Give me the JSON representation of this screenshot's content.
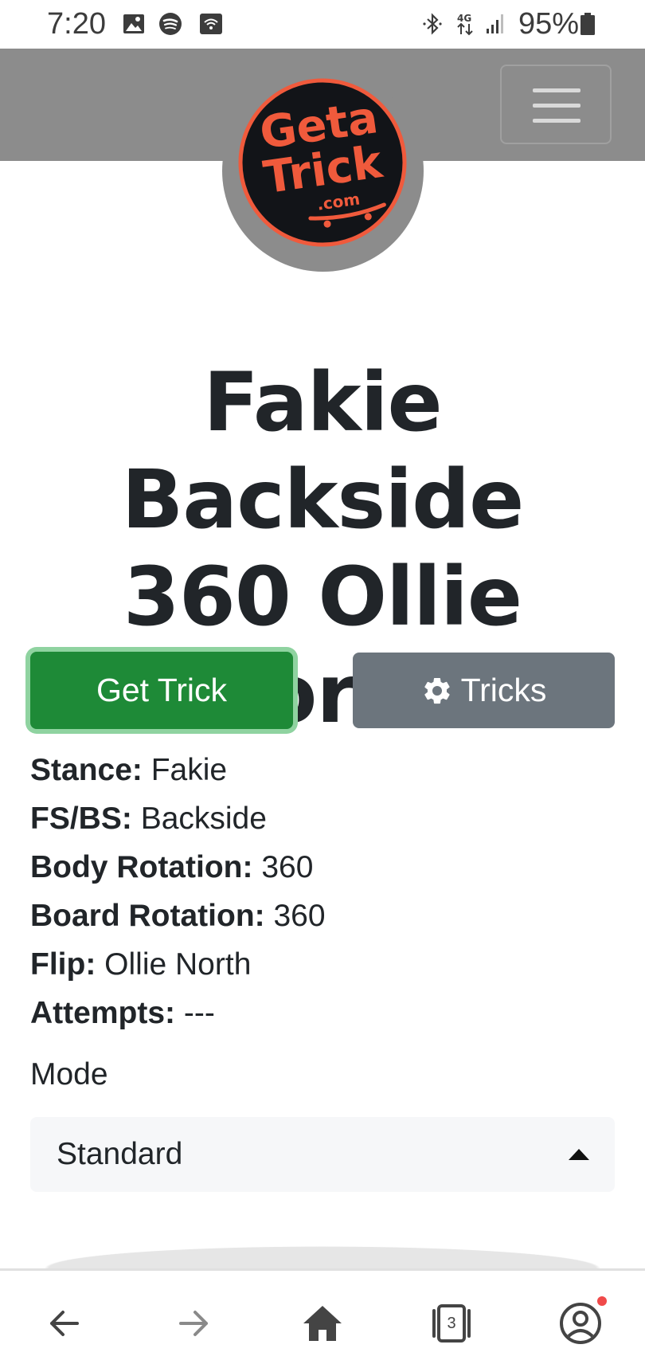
{
  "status_bar": {
    "time": "7:20",
    "battery": "95%",
    "icons": [
      "gallery-icon",
      "spotify-icon",
      "wifi-calling-icon",
      "bluetooth-icon",
      "4g-icon",
      "signal-icon",
      "battery-icon"
    ]
  },
  "logo": {
    "line1": "Geta",
    "line2": "Trick",
    "line3": ".com",
    "colors": {
      "text": "#f05a3c",
      "background": "#121418",
      "ring": "#f05a3c"
    }
  },
  "title": {
    "line1": "Fakie Backside",
    "line2": "360 Ollie North"
  },
  "buttons": {
    "get_trick": "Get Trick",
    "tricks": "Tricks"
  },
  "details": [
    {
      "label": "Stance:",
      "value": "Fakie"
    },
    {
      "label": "FS/BS:",
      "value": "Backside"
    },
    {
      "label": "Body Rotation:",
      "value": "360"
    },
    {
      "label": "Board Rotation:",
      "value": "360"
    },
    {
      "label": "Flip:",
      "value": "Ollie North"
    },
    {
      "label": "Attempts:",
      "value": "---"
    }
  ],
  "mode": {
    "label": "Mode",
    "selected": "Standard"
  },
  "browser_nav": {
    "tab_count": "3"
  },
  "colors": {
    "navbar": "#8c8c8c",
    "primary_success": "#1e8a37",
    "secondary": "#6c757d",
    "text": "#212529"
  }
}
